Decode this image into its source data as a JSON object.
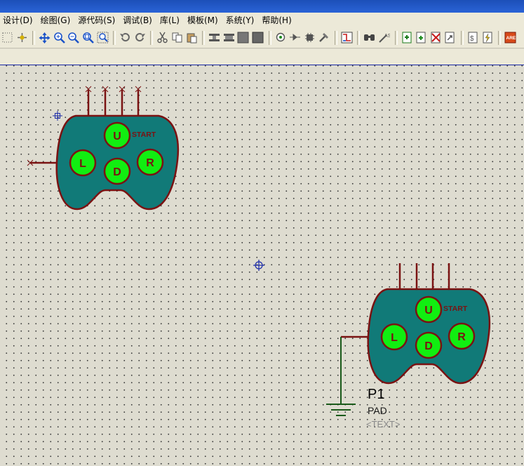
{
  "menu": [
    "设计(D)",
    "绘图(G)",
    "源代码(S)",
    "调试(B)",
    "库(L)",
    "模板(M)",
    "系统(Y)",
    "帮助(H)"
  ],
  "toolbar_icons": [
    {
      "name": "grid-icon",
      "group": 0
    },
    {
      "name": "origin-icon",
      "group": 0
    },
    {
      "name": "pan-icon",
      "group": 1
    },
    {
      "name": "zoom-in-icon",
      "group": 1
    },
    {
      "name": "zoom-out-icon",
      "group": 1
    },
    {
      "name": "zoom-all-icon",
      "group": 1
    },
    {
      "name": "zoom-area-icon",
      "group": 1
    },
    {
      "name": "undo-icon",
      "group": 2
    },
    {
      "name": "redo-icon",
      "group": 2
    },
    {
      "name": "cut-icon",
      "group": 3
    },
    {
      "name": "copy-icon",
      "group": 3
    },
    {
      "name": "paste-icon",
      "group": 3
    },
    {
      "name": "block-copy-icon",
      "group": 4
    },
    {
      "name": "block-move-icon",
      "group": 4
    },
    {
      "name": "block-rotate-icon",
      "group": 4
    },
    {
      "name": "block-delete-icon",
      "group": 4
    },
    {
      "name": "pick-device-icon",
      "group": 5
    },
    {
      "name": "make-device-icon",
      "group": 5
    },
    {
      "name": "package-tool-icon",
      "group": 5
    },
    {
      "name": "decompose-icon",
      "group": 5
    },
    {
      "name": "wire-autorouter-icon",
      "group": 6
    },
    {
      "name": "search-icon",
      "group": 7
    },
    {
      "name": "property-tool-icon",
      "group": 7
    },
    {
      "name": "new-sheet-icon",
      "group": 8
    },
    {
      "name": "add-sheet-icon",
      "group": 8
    },
    {
      "name": "remove-sheet-icon",
      "group": 8
    },
    {
      "name": "goto-sheet-icon",
      "group": 8
    },
    {
      "name": "bill-of-materials-icon",
      "group": 9
    },
    {
      "name": "electrical-check-icon",
      "group": 9
    },
    {
      "name": "ares-netlist-icon",
      "group": 10
    }
  ],
  "components": [
    {
      "id": "pad-1",
      "button_labels": {
        "up": "U",
        "down": "D",
        "left": "L",
        "right": "R",
        "start": "START"
      }
    },
    {
      "id": "pad-2",
      "reference": "P1",
      "value": "PAD",
      "text_placeholder": "<TEXT>",
      "button_labels": {
        "up": "U",
        "down": "D",
        "left": "L",
        "right": "R",
        "start": "START"
      }
    }
  ],
  "colors": {
    "body_fill": "#117a78",
    "outline": "#7a1212",
    "button_fill": "#11ee11",
    "wire": "#7a1212",
    "ground_wire": "#1a5a1a",
    "cursor": "#1a2aa8",
    "grid_dot": "#3a3a3a",
    "canvas": "#dedcd0",
    "chrome": "#ece9d8"
  }
}
